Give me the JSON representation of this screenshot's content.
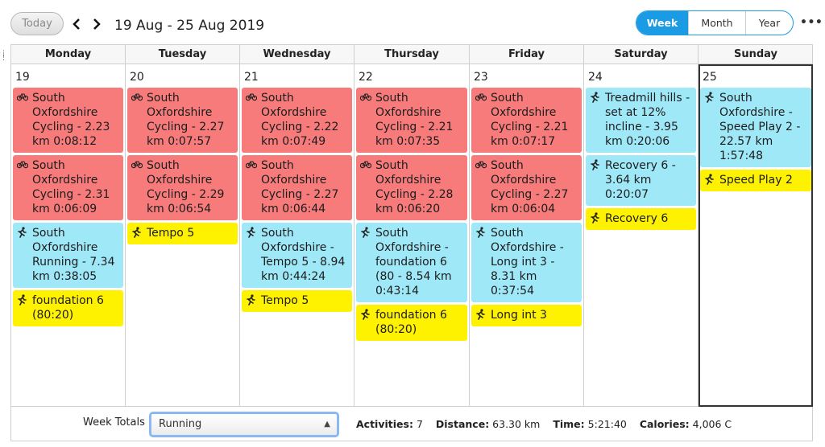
{
  "toolbar": {
    "today_label": "Today",
    "prev_icon": "‹",
    "next_icon": "›",
    "range_title": "19 Aug - 25 Aug 2019",
    "views": [
      "Week",
      "Month",
      "Year"
    ],
    "active_view": "Week",
    "more_icon": "•••"
  },
  "calendar": {
    "days": [
      {
        "name": "Monday",
        "date": "19",
        "events": [
          {
            "kind": "cycling",
            "text": "South Oxfordshire Cycling - 2.31 km 0:06:09"
          },
          {
            "kind": "running",
            "text": "South Oxfordshire Running - 7.34 km 0:38:05"
          },
          {
            "kind": "planned",
            "text": "foundation 6 (80:20)"
          }
        ]
      },
      {
        "name": "Tuesday",
        "date": "20",
        "events": [
          {
            "kind": "cycling",
            "text": "South Oxfordshire Cycling - 2.27 km 0:07:57"
          },
          {
            "kind": "cycling",
            "text": "South Oxfordshire Cycling - 2.29 km 0:06:54"
          },
          {
            "kind": "planned",
            "text": "Tempo 5"
          }
        ]
      },
      {
        "name": "Wednesday",
        "date": "21",
        "events": [
          {
            "kind": "cycling",
            "text": "South Oxfordshire Cycling - 2.22 km 0:07:49"
          },
          {
            "kind": "cycling",
            "text": "South Oxfordshire Cycling - 2.27 km 0:06:44"
          },
          {
            "kind": "running",
            "text": "South Oxfordshire - Tempo 5 - 8.94 km 0:44:24"
          },
          {
            "kind": "planned",
            "text": "Tempo 5"
          }
        ]
      },
      {
        "name": "Thursday",
        "date": "22",
        "events": [
          {
            "kind": "cycling",
            "text": "South Oxfordshire Cycling - 2.21 km 0:07:35"
          },
          {
            "kind": "cycling",
            "text": "South Oxfordshire Cycling - 2.28 km 0:06:20"
          },
          {
            "kind": "running",
            "text": "South Oxfordshire - foundation 6 (80 - 8.54 km 0:43:14"
          },
          {
            "kind": "planned",
            "text": "foundation 6 (80:20)"
          }
        ]
      },
      {
        "name": "Friday",
        "date": "23",
        "events": [
          {
            "kind": "cycling",
            "text": "South Oxfordshire Cycling - 2.21 km 0:07:17"
          },
          {
            "kind": "cycling",
            "text": "South Oxfordshire Cycling - 2.27 km 0:06:04"
          },
          {
            "kind": "running",
            "text": "South Oxfordshire - Long int 3 - 8.31 km 0:37:54"
          },
          {
            "kind": "planned",
            "text": "Long int 3"
          }
        ]
      },
      {
        "name": "Saturday",
        "date": "24",
        "events": [
          {
            "kind": "running",
            "text": "Treadmill hills - set at 12% incline  - 3.95 km 0:20:06"
          },
          {
            "kind": "running",
            "text": "Recovery 6 - 3.64 km 0:20:07"
          },
          {
            "kind": "planned",
            "text": "Recovery 6"
          }
        ]
      },
      {
        "name": "Sunday",
        "date": "25",
        "today": true,
        "events": [
          {
            "kind": "running",
            "text": "South Oxfordshire - Speed Play 2 - 22.57 km 1:57:48"
          },
          {
            "kind": "planned",
            "text": "Speed Play 2"
          }
        ]
      }
    ],
    "first_events": [
      {
        "kind": "cycling",
        "text": "South Oxfordshire Cycling - 2.23 km 0:08:12"
      }
    ]
  },
  "footer": {
    "week_totals_label": "Week Totals",
    "sport_selected": "Running",
    "activities_label": "Activities:",
    "activities_value": "7",
    "distance_label": "Distance:",
    "distance_value": "63.30 km",
    "time_label": "Time:",
    "time_value": "5:21:40",
    "calories_label": "Calories:",
    "calories_value": "4,006 C"
  },
  "colors": {
    "accent": "#1a9be4",
    "cycling": "#f77b7b",
    "running": "#9fe8f8",
    "planned": "#fff200"
  },
  "icons": {
    "cycling": "bicycle-icon",
    "running": "runner-icon"
  }
}
